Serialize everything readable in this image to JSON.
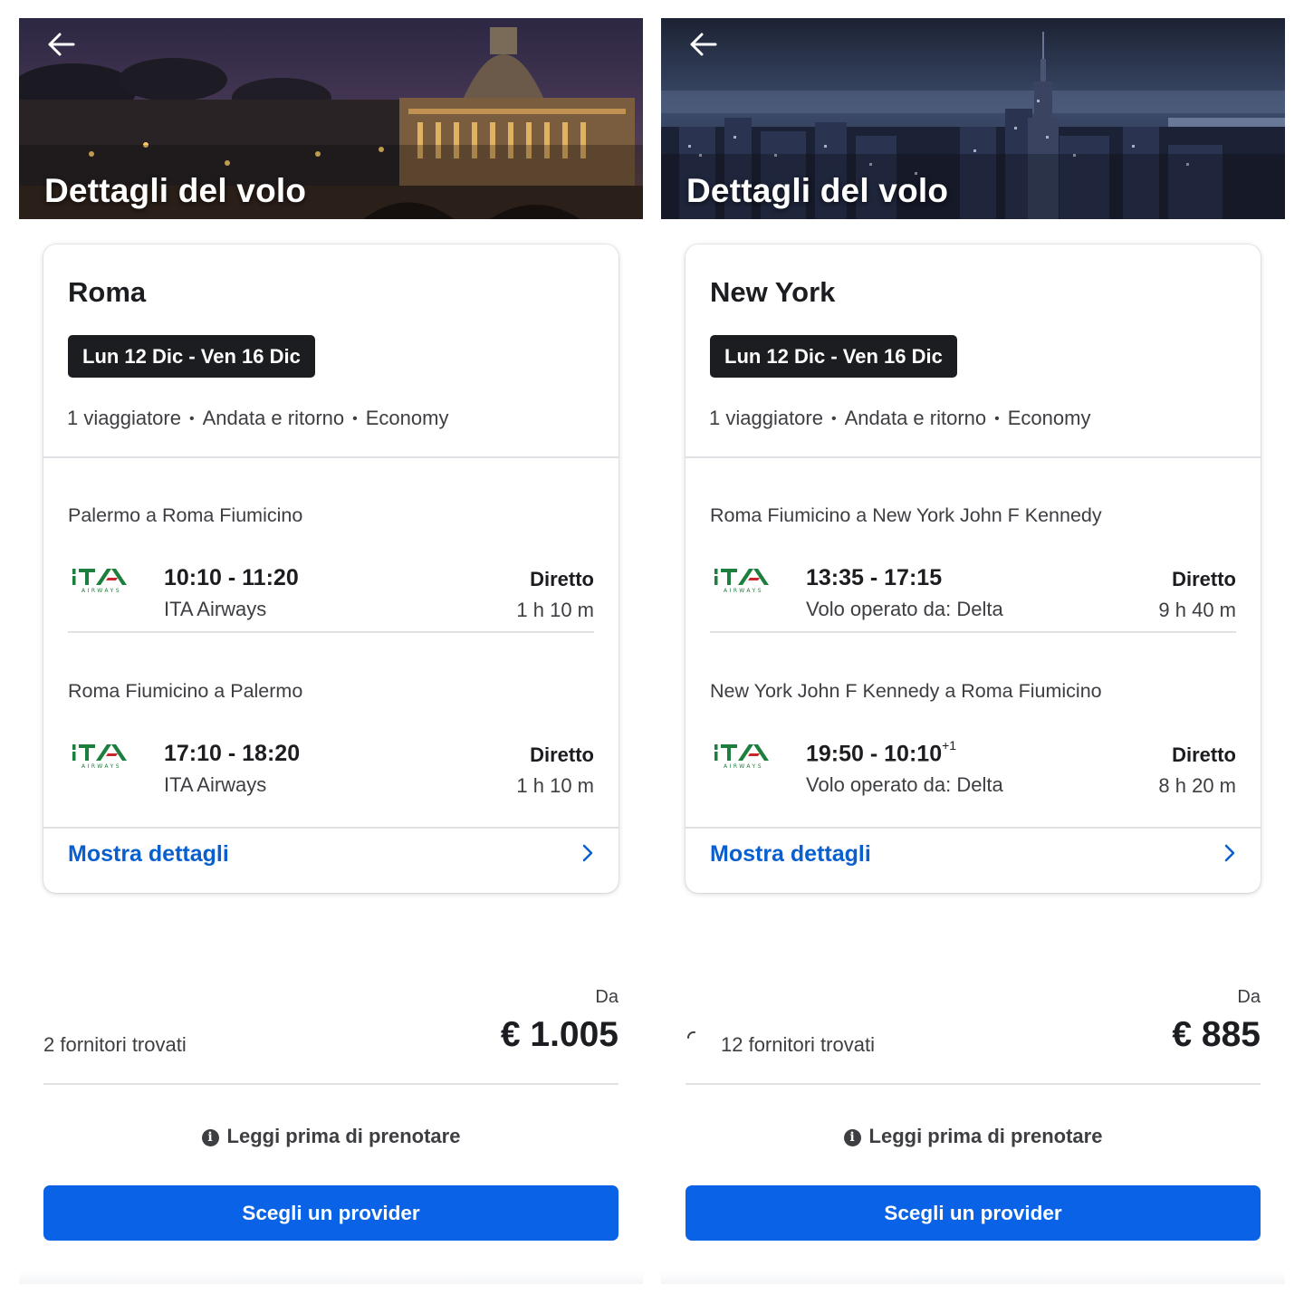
{
  "colors": {
    "accent": "#0a5fcf",
    "button": "#0a63e6",
    "pill": "#1c1d20",
    "logo_green": "#1d7f3e",
    "logo_red": "#c8252c"
  },
  "screens": [
    {
      "hero": {
        "title": "Dettagli del volo",
        "image": "rome-night-skyline",
        "back_icon": "arrow-left-icon"
      },
      "card": {
        "city": "Roma",
        "dates": "Lun 12 Dic - Ven 16 Dic",
        "meta": [
          "1 viaggiatore",
          "Andata e ritorno",
          "Economy"
        ],
        "legs": [
          {
            "route": "Palermo a Roma Fiumicino",
            "times": "10:10 - 11:20",
            "day_offset": "",
            "airline": "ITA Airways",
            "stops": "Diretto",
            "duration": "1 h 10 m",
            "logo": "ita-airways-logo"
          },
          {
            "route": "Roma Fiumicino a Palermo",
            "times": "17:10 - 18:20",
            "day_offset": "",
            "airline": "ITA Airways",
            "stops": "Diretto",
            "duration": "1 h 10 m",
            "logo": "ita-airways-logo"
          }
        ],
        "details_link": "Mostra dettagli"
      },
      "pricing": {
        "providers": "2 fornitori trovati",
        "from_label": "Da",
        "price": "€ 1.005"
      },
      "read_first": "Leggi prima di prenotare",
      "cta": "Scegli un provider"
    },
    {
      "hero": {
        "title": "Dettagli del volo",
        "image": "new-york-night-skyline",
        "back_icon": "arrow-left-icon"
      },
      "card": {
        "city": "New York",
        "dates": "Lun 12 Dic - Ven 16 Dic",
        "meta": [
          "1 viaggiatore",
          "Andata e ritorno",
          "Economy"
        ],
        "legs": [
          {
            "route": "Roma Fiumicino a New York John F Kennedy",
            "times": "13:35 - 17:15",
            "day_offset": "",
            "airline": "Volo operato da: Delta",
            "stops": "Diretto",
            "duration": "9 h 40 m",
            "logo": "ita-airways-logo"
          },
          {
            "route": "New York John F Kennedy a Roma Fiumicino",
            "times": "19:50 - 10:10",
            "day_offset": "+1",
            "airline": "Volo operato da: Delta",
            "stops": "Diretto",
            "duration": "8 h 20 m",
            "logo": "ita-airways-logo"
          }
        ],
        "details_link": "Mostra dettagli"
      },
      "pricing": {
        "providers": "12 fornitori trovati",
        "from_label": "Da",
        "price": "€ 885"
      },
      "read_first": "Leggi prima di prenotare",
      "cta": "Scegli un provider"
    }
  ]
}
